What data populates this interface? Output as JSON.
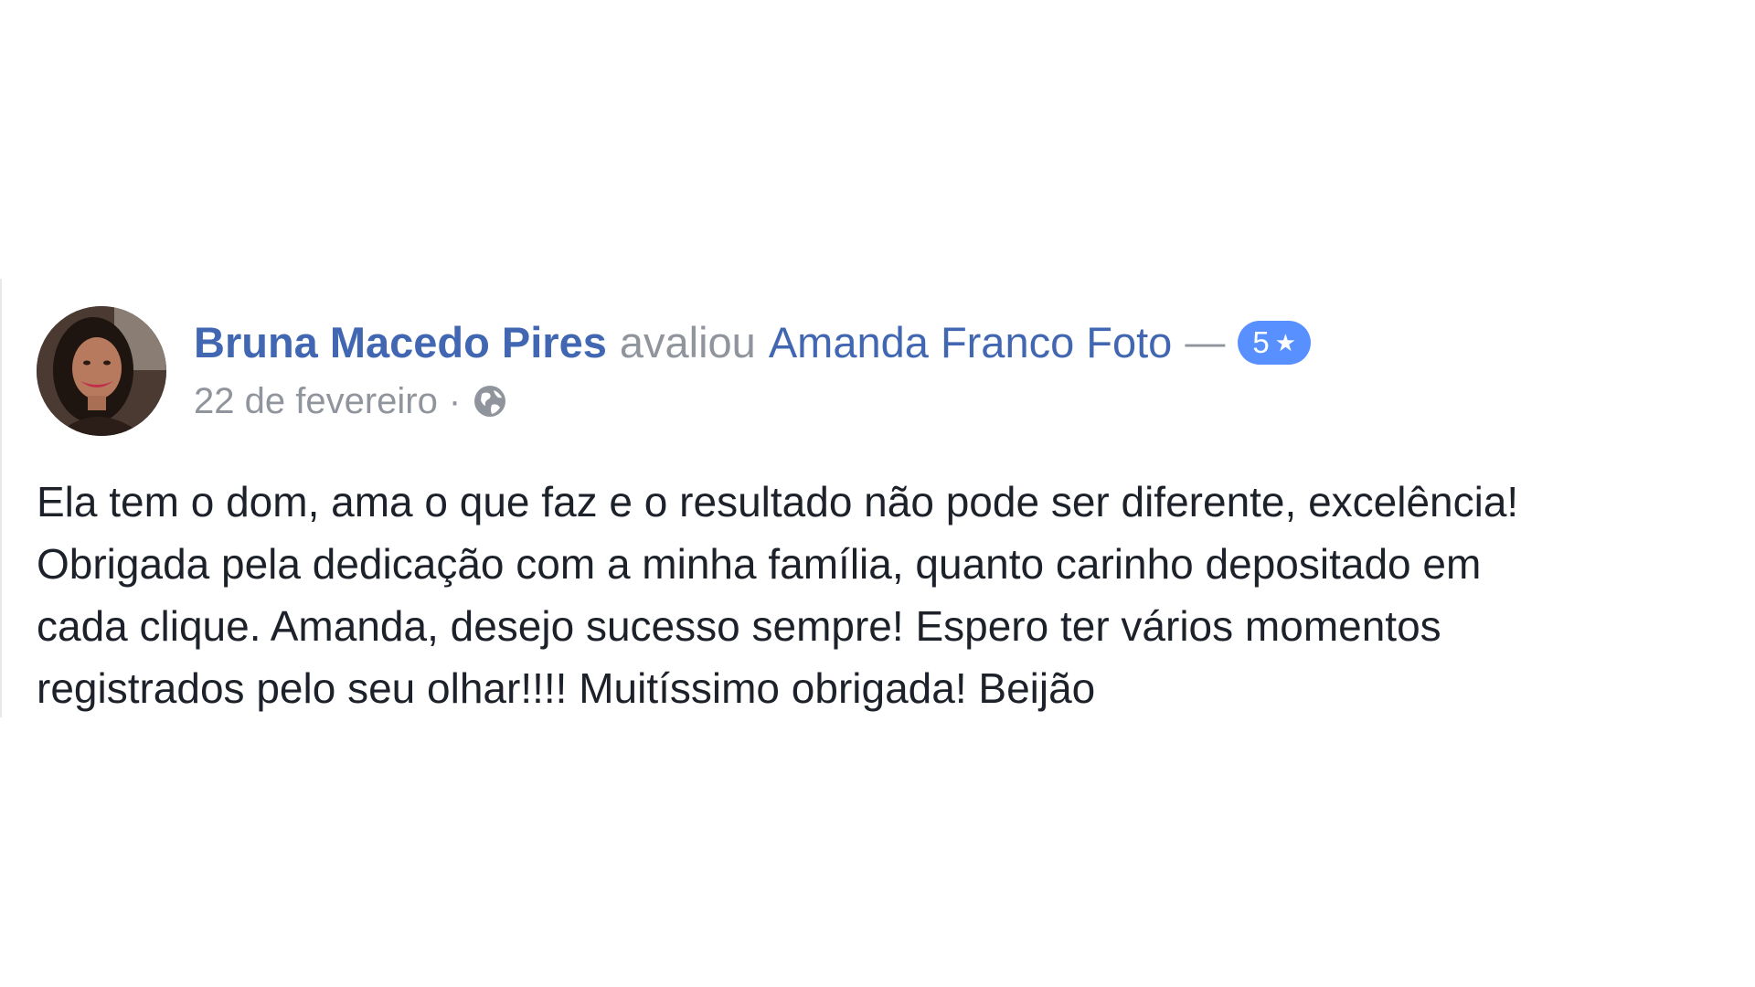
{
  "review": {
    "author_name": "Bruna Macedo Pires",
    "action_text": "avaliou",
    "page_name": "Amanda Franco Foto",
    "separator": "—",
    "rating": "5",
    "rating_icon": "star-icon",
    "date": "22 de fevereiro",
    "date_separator": "·",
    "privacy_icon": "globe-icon",
    "body_lines": [
      "Ela tem o dom, ama o que faz e o resultado não pode ser diferente, excelência!",
      "Obrigada pela dedicação com a minha família, quanto carinho depositado em",
      "cada clique. Amanda, desejo sucesso sempre! Espero ter vários momentos",
      "registrados pelo seu olhar!!!! Muitíssimo obrigada! Beijão"
    ]
  },
  "colors": {
    "link_blue": "#4267b2",
    "meta_gray": "#90949c",
    "badge_blue": "#5890ff",
    "body_text": "#1d2129"
  }
}
